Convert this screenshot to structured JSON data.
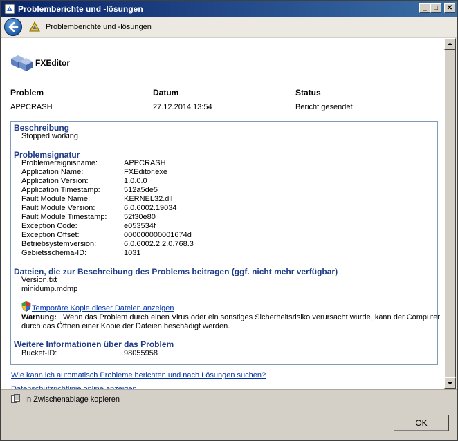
{
  "window": {
    "title": "Problemberichte und -lösungen",
    "minimize_glyph": "_",
    "maximize_glyph": "□",
    "close_glyph": "✕"
  },
  "nav": {
    "title": "Problemberichte und -lösungen"
  },
  "app": {
    "name": "FXEditor"
  },
  "summary": {
    "headers": {
      "problem": "Problem",
      "datum": "Datum",
      "status": "Status"
    },
    "values": {
      "problem": "APPCRASH",
      "datum": "27.12.2014 13:54",
      "status": "Bericht gesendet"
    }
  },
  "description": {
    "heading": "Beschreibung",
    "text": "Stopped working"
  },
  "signature": {
    "heading": "Problemsignatur",
    "rows": [
      {
        "label": "Problemereignisname:",
        "value": "APPCRASH"
      },
      {
        "label": "Application Name:",
        "value": "FXEditor.exe"
      },
      {
        "label": "Application Version:",
        "value": "1.0.0.0"
      },
      {
        "label": "Application Timestamp:",
        "value": "512a5de5"
      },
      {
        "label": "Fault Module Name:",
        "value": "KERNEL32.dll"
      },
      {
        "label": "Fault Module Version:",
        "value": "6.0.6002.19034"
      },
      {
        "label": "Fault Module Timestamp:",
        "value": "52f30e80"
      },
      {
        "label": "Exception Code:",
        "value": "e053534f"
      },
      {
        "label": "Exception Offset:",
        "value": "000000000001674d"
      },
      {
        "label": "Betriebsystemversion:",
        "value": "6.0.6002.2.2.0.768.3"
      },
      {
        "label": "Gebietsschema-ID:",
        "value": "1031"
      }
    ]
  },
  "files": {
    "heading": "Dateien, die zur Beschreibung des Problems beitragen (ggf. nicht mehr verfügbar)",
    "items": [
      "Version.txt",
      "minidump.mdmp"
    ],
    "show_copy_link": "Temporäre Kopie dieser Dateien anzeigen",
    "warning_label": "Warnung:",
    "warning_line1": "Wenn das Problem durch einen Virus oder ein sonstiges Sicherheitsrisiko verursacht wurde, kann der Computer",
    "warning_line2": "durch das Öffnen einer Kopie der Dateien beschädigt werden."
  },
  "more_info": {
    "heading": "Weitere Informationen über das Problem",
    "bucket_label": "Bucket-ID:",
    "bucket_value": "98055958"
  },
  "links": {
    "auto_report": "Wie kann ich automatisch Probleme berichten und nach Lösungen suchen?",
    "privacy_cut": "Datenschutzrichtlinie online anzeigen"
  },
  "bottom": {
    "copy_clipboard": "In Zwischenablage kopieren",
    "ok": "OK"
  },
  "colors": {
    "title_start": "#0a246a",
    "title_end": "#3a6ea5",
    "section_heading": "#1f3c88",
    "link": "#0033aa"
  }
}
